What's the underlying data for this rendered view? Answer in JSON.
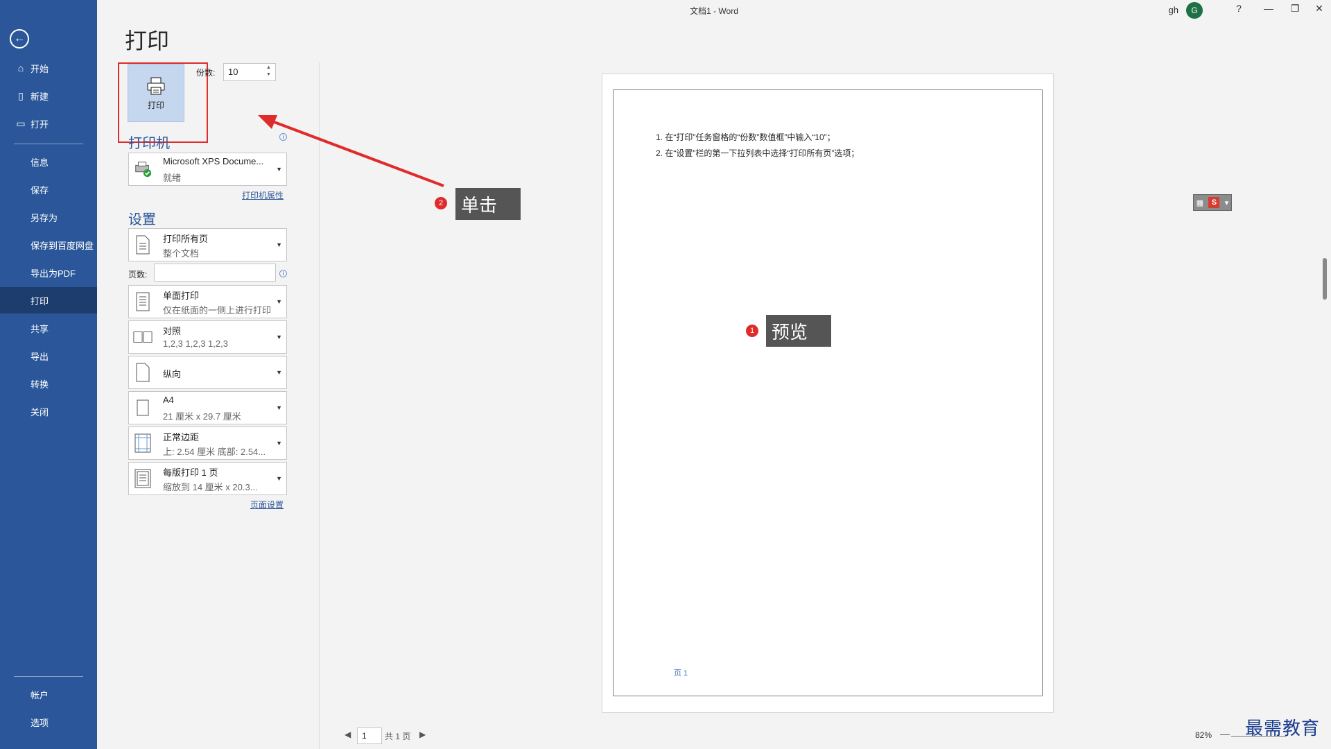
{
  "window": {
    "title": "文档1  -  Word",
    "user": "gh",
    "avatar_initial": "G",
    "help": "?",
    "minimize": "—",
    "restore": "❐",
    "close": "✕"
  },
  "sidebar": {
    "back_icon": "←",
    "items": [
      {
        "label": "开始",
        "icon": "home-icon",
        "glyph": "⌂"
      },
      {
        "label": "新建",
        "icon": "new-document-icon",
        "glyph": "▯"
      },
      {
        "label": "打开",
        "icon": "open-folder-icon",
        "glyph": "▭"
      },
      {
        "label": "信息"
      },
      {
        "label": "保存"
      },
      {
        "label": "另存为"
      },
      {
        "label": "保存到百度网盘"
      },
      {
        "label": "导出为PDF"
      },
      {
        "label": "打印",
        "active": true
      },
      {
        "label": "共享"
      },
      {
        "label": "导出"
      },
      {
        "label": "转换"
      },
      {
        "label": "关闭"
      }
    ],
    "bottom_items": [
      {
        "label": "帐户"
      },
      {
        "label": "选项"
      }
    ]
  },
  "print": {
    "heading": "打印",
    "button_label": "打印",
    "copies_label": "份数:",
    "copies_value": "10",
    "printer_heading": "打印机",
    "printer_name": "Microsoft XPS Docume...",
    "printer_status": "就绪",
    "printer_properties_link": "打印机属性",
    "settings_heading": "设置",
    "pages_label": "页数:",
    "pages_value": "",
    "page_setup_link": "页面设置",
    "settings": [
      {
        "title": "打印所有页",
        "subtitle": "整个文档",
        "icon": "document-pages-icon"
      },
      {
        "title": "单面打印",
        "subtitle": "仅在纸面的一侧上进行打印",
        "icon": "one-sided-icon"
      },
      {
        "title": "对照",
        "subtitle": "1,2,3    1,2,3    1,2,3",
        "icon": "collate-icon"
      },
      {
        "title": "纵向",
        "subtitle": "",
        "icon": "portrait-icon"
      },
      {
        "title": "A4",
        "subtitle": "21 厘米 x 29.7 厘米",
        "icon": "paper-size-icon"
      },
      {
        "title": "正常边距",
        "subtitle": "上: 2.54 厘米 底部: 2.54...",
        "icon": "margins-icon"
      },
      {
        "title": "每版打印 1 页",
        "subtitle": "缩放到 14 厘米 x 20.3...",
        "icon": "pages-per-sheet-icon"
      }
    ]
  },
  "preview": {
    "lines": [
      "1.  在“打印”任务窗格的“份数”数值框”中输入“10”；",
      "2.  在“设置”栏的第一下拉列表中选择“打印所有页”选项；"
    ],
    "footer": "页 1"
  },
  "annotations": {
    "click_badge": "2",
    "click_label": "单击",
    "preview_badge": "1",
    "preview_label": "预览",
    "colors": {
      "highlight": "#e02b2b",
      "note_bg": "#555555"
    }
  },
  "page_nav": {
    "prev": "◀",
    "current": "1",
    "total": "共 1 页",
    "next": "▶"
  },
  "zoom": {
    "level": "82%",
    "minus": "—"
  },
  "watermark": "最需教育",
  "colors": {
    "sidebar": "#2b579a",
    "sidebar_active": "#1c3d6e",
    "accent": "#2b579a"
  }
}
